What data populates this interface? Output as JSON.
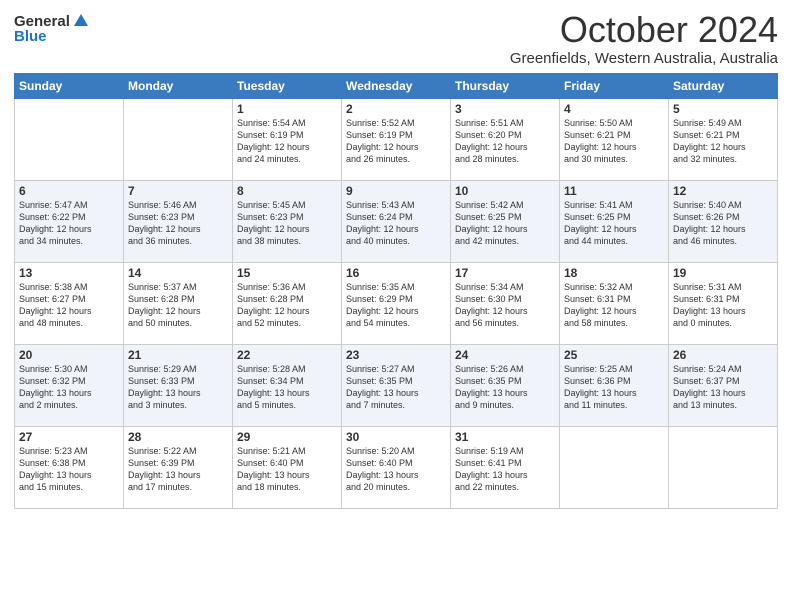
{
  "logo": {
    "general": "General",
    "blue": "Blue"
  },
  "header": {
    "month": "October 2024",
    "location": "Greenfields, Western Australia, Australia"
  },
  "weekdays": [
    "Sunday",
    "Monday",
    "Tuesday",
    "Wednesday",
    "Thursday",
    "Friday",
    "Saturday"
  ],
  "weeks": [
    [
      {
        "day": "",
        "info": ""
      },
      {
        "day": "",
        "info": ""
      },
      {
        "day": "1",
        "info": "Sunrise: 5:54 AM\nSunset: 6:19 PM\nDaylight: 12 hours\nand 24 minutes."
      },
      {
        "day": "2",
        "info": "Sunrise: 5:52 AM\nSunset: 6:19 PM\nDaylight: 12 hours\nand 26 minutes."
      },
      {
        "day": "3",
        "info": "Sunrise: 5:51 AM\nSunset: 6:20 PM\nDaylight: 12 hours\nand 28 minutes."
      },
      {
        "day": "4",
        "info": "Sunrise: 5:50 AM\nSunset: 6:21 PM\nDaylight: 12 hours\nand 30 minutes."
      },
      {
        "day": "5",
        "info": "Sunrise: 5:49 AM\nSunset: 6:21 PM\nDaylight: 12 hours\nand 32 minutes."
      }
    ],
    [
      {
        "day": "6",
        "info": "Sunrise: 5:47 AM\nSunset: 6:22 PM\nDaylight: 12 hours\nand 34 minutes."
      },
      {
        "day": "7",
        "info": "Sunrise: 5:46 AM\nSunset: 6:23 PM\nDaylight: 12 hours\nand 36 minutes."
      },
      {
        "day": "8",
        "info": "Sunrise: 5:45 AM\nSunset: 6:23 PM\nDaylight: 12 hours\nand 38 minutes."
      },
      {
        "day": "9",
        "info": "Sunrise: 5:43 AM\nSunset: 6:24 PM\nDaylight: 12 hours\nand 40 minutes."
      },
      {
        "day": "10",
        "info": "Sunrise: 5:42 AM\nSunset: 6:25 PM\nDaylight: 12 hours\nand 42 minutes."
      },
      {
        "day": "11",
        "info": "Sunrise: 5:41 AM\nSunset: 6:25 PM\nDaylight: 12 hours\nand 44 minutes."
      },
      {
        "day": "12",
        "info": "Sunrise: 5:40 AM\nSunset: 6:26 PM\nDaylight: 12 hours\nand 46 minutes."
      }
    ],
    [
      {
        "day": "13",
        "info": "Sunrise: 5:38 AM\nSunset: 6:27 PM\nDaylight: 12 hours\nand 48 minutes."
      },
      {
        "day": "14",
        "info": "Sunrise: 5:37 AM\nSunset: 6:28 PM\nDaylight: 12 hours\nand 50 minutes."
      },
      {
        "day": "15",
        "info": "Sunrise: 5:36 AM\nSunset: 6:28 PM\nDaylight: 12 hours\nand 52 minutes."
      },
      {
        "day": "16",
        "info": "Sunrise: 5:35 AM\nSunset: 6:29 PM\nDaylight: 12 hours\nand 54 minutes."
      },
      {
        "day": "17",
        "info": "Sunrise: 5:34 AM\nSunset: 6:30 PM\nDaylight: 12 hours\nand 56 minutes."
      },
      {
        "day": "18",
        "info": "Sunrise: 5:32 AM\nSunset: 6:31 PM\nDaylight: 12 hours\nand 58 minutes."
      },
      {
        "day": "19",
        "info": "Sunrise: 5:31 AM\nSunset: 6:31 PM\nDaylight: 13 hours\nand 0 minutes."
      }
    ],
    [
      {
        "day": "20",
        "info": "Sunrise: 5:30 AM\nSunset: 6:32 PM\nDaylight: 13 hours\nand 2 minutes."
      },
      {
        "day": "21",
        "info": "Sunrise: 5:29 AM\nSunset: 6:33 PM\nDaylight: 13 hours\nand 3 minutes."
      },
      {
        "day": "22",
        "info": "Sunrise: 5:28 AM\nSunset: 6:34 PM\nDaylight: 13 hours\nand 5 minutes."
      },
      {
        "day": "23",
        "info": "Sunrise: 5:27 AM\nSunset: 6:35 PM\nDaylight: 13 hours\nand 7 minutes."
      },
      {
        "day": "24",
        "info": "Sunrise: 5:26 AM\nSunset: 6:35 PM\nDaylight: 13 hours\nand 9 minutes."
      },
      {
        "day": "25",
        "info": "Sunrise: 5:25 AM\nSunset: 6:36 PM\nDaylight: 13 hours\nand 11 minutes."
      },
      {
        "day": "26",
        "info": "Sunrise: 5:24 AM\nSunset: 6:37 PM\nDaylight: 13 hours\nand 13 minutes."
      }
    ],
    [
      {
        "day": "27",
        "info": "Sunrise: 5:23 AM\nSunset: 6:38 PM\nDaylight: 13 hours\nand 15 minutes."
      },
      {
        "day": "28",
        "info": "Sunrise: 5:22 AM\nSunset: 6:39 PM\nDaylight: 13 hours\nand 17 minutes."
      },
      {
        "day": "29",
        "info": "Sunrise: 5:21 AM\nSunset: 6:40 PM\nDaylight: 13 hours\nand 18 minutes."
      },
      {
        "day": "30",
        "info": "Sunrise: 5:20 AM\nSunset: 6:40 PM\nDaylight: 13 hours\nand 20 minutes."
      },
      {
        "day": "31",
        "info": "Sunrise: 5:19 AM\nSunset: 6:41 PM\nDaylight: 13 hours\nand 22 minutes."
      },
      {
        "day": "",
        "info": ""
      },
      {
        "day": "",
        "info": ""
      }
    ]
  ]
}
